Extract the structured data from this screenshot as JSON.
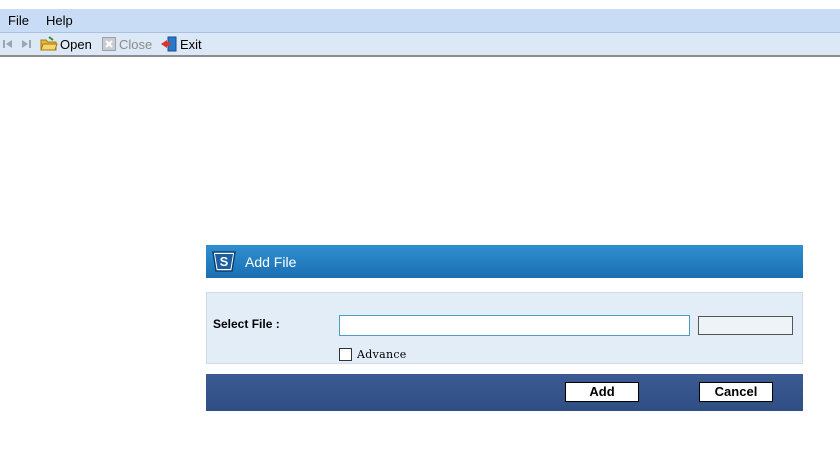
{
  "menubar": {
    "items": [
      {
        "label": "File"
      },
      {
        "label": "Help"
      }
    ]
  },
  "toolbar": {
    "open_label": "Open",
    "close_label": "Close",
    "exit_label": "Exit"
  },
  "dialog": {
    "title": "Add File",
    "select_file_label": "Select File :",
    "path_value": "",
    "advance_label": "Advance",
    "advance_checked": false,
    "add_label": "Add",
    "cancel_label": "Cancel"
  },
  "colors": {
    "menubar_bg": "#c9dcf5",
    "toolbar_bg": "#dde8f6",
    "dialog_header": "#1f7bbf",
    "dialog_body": "#e3edf8",
    "dialog_footer": "#34558b"
  }
}
